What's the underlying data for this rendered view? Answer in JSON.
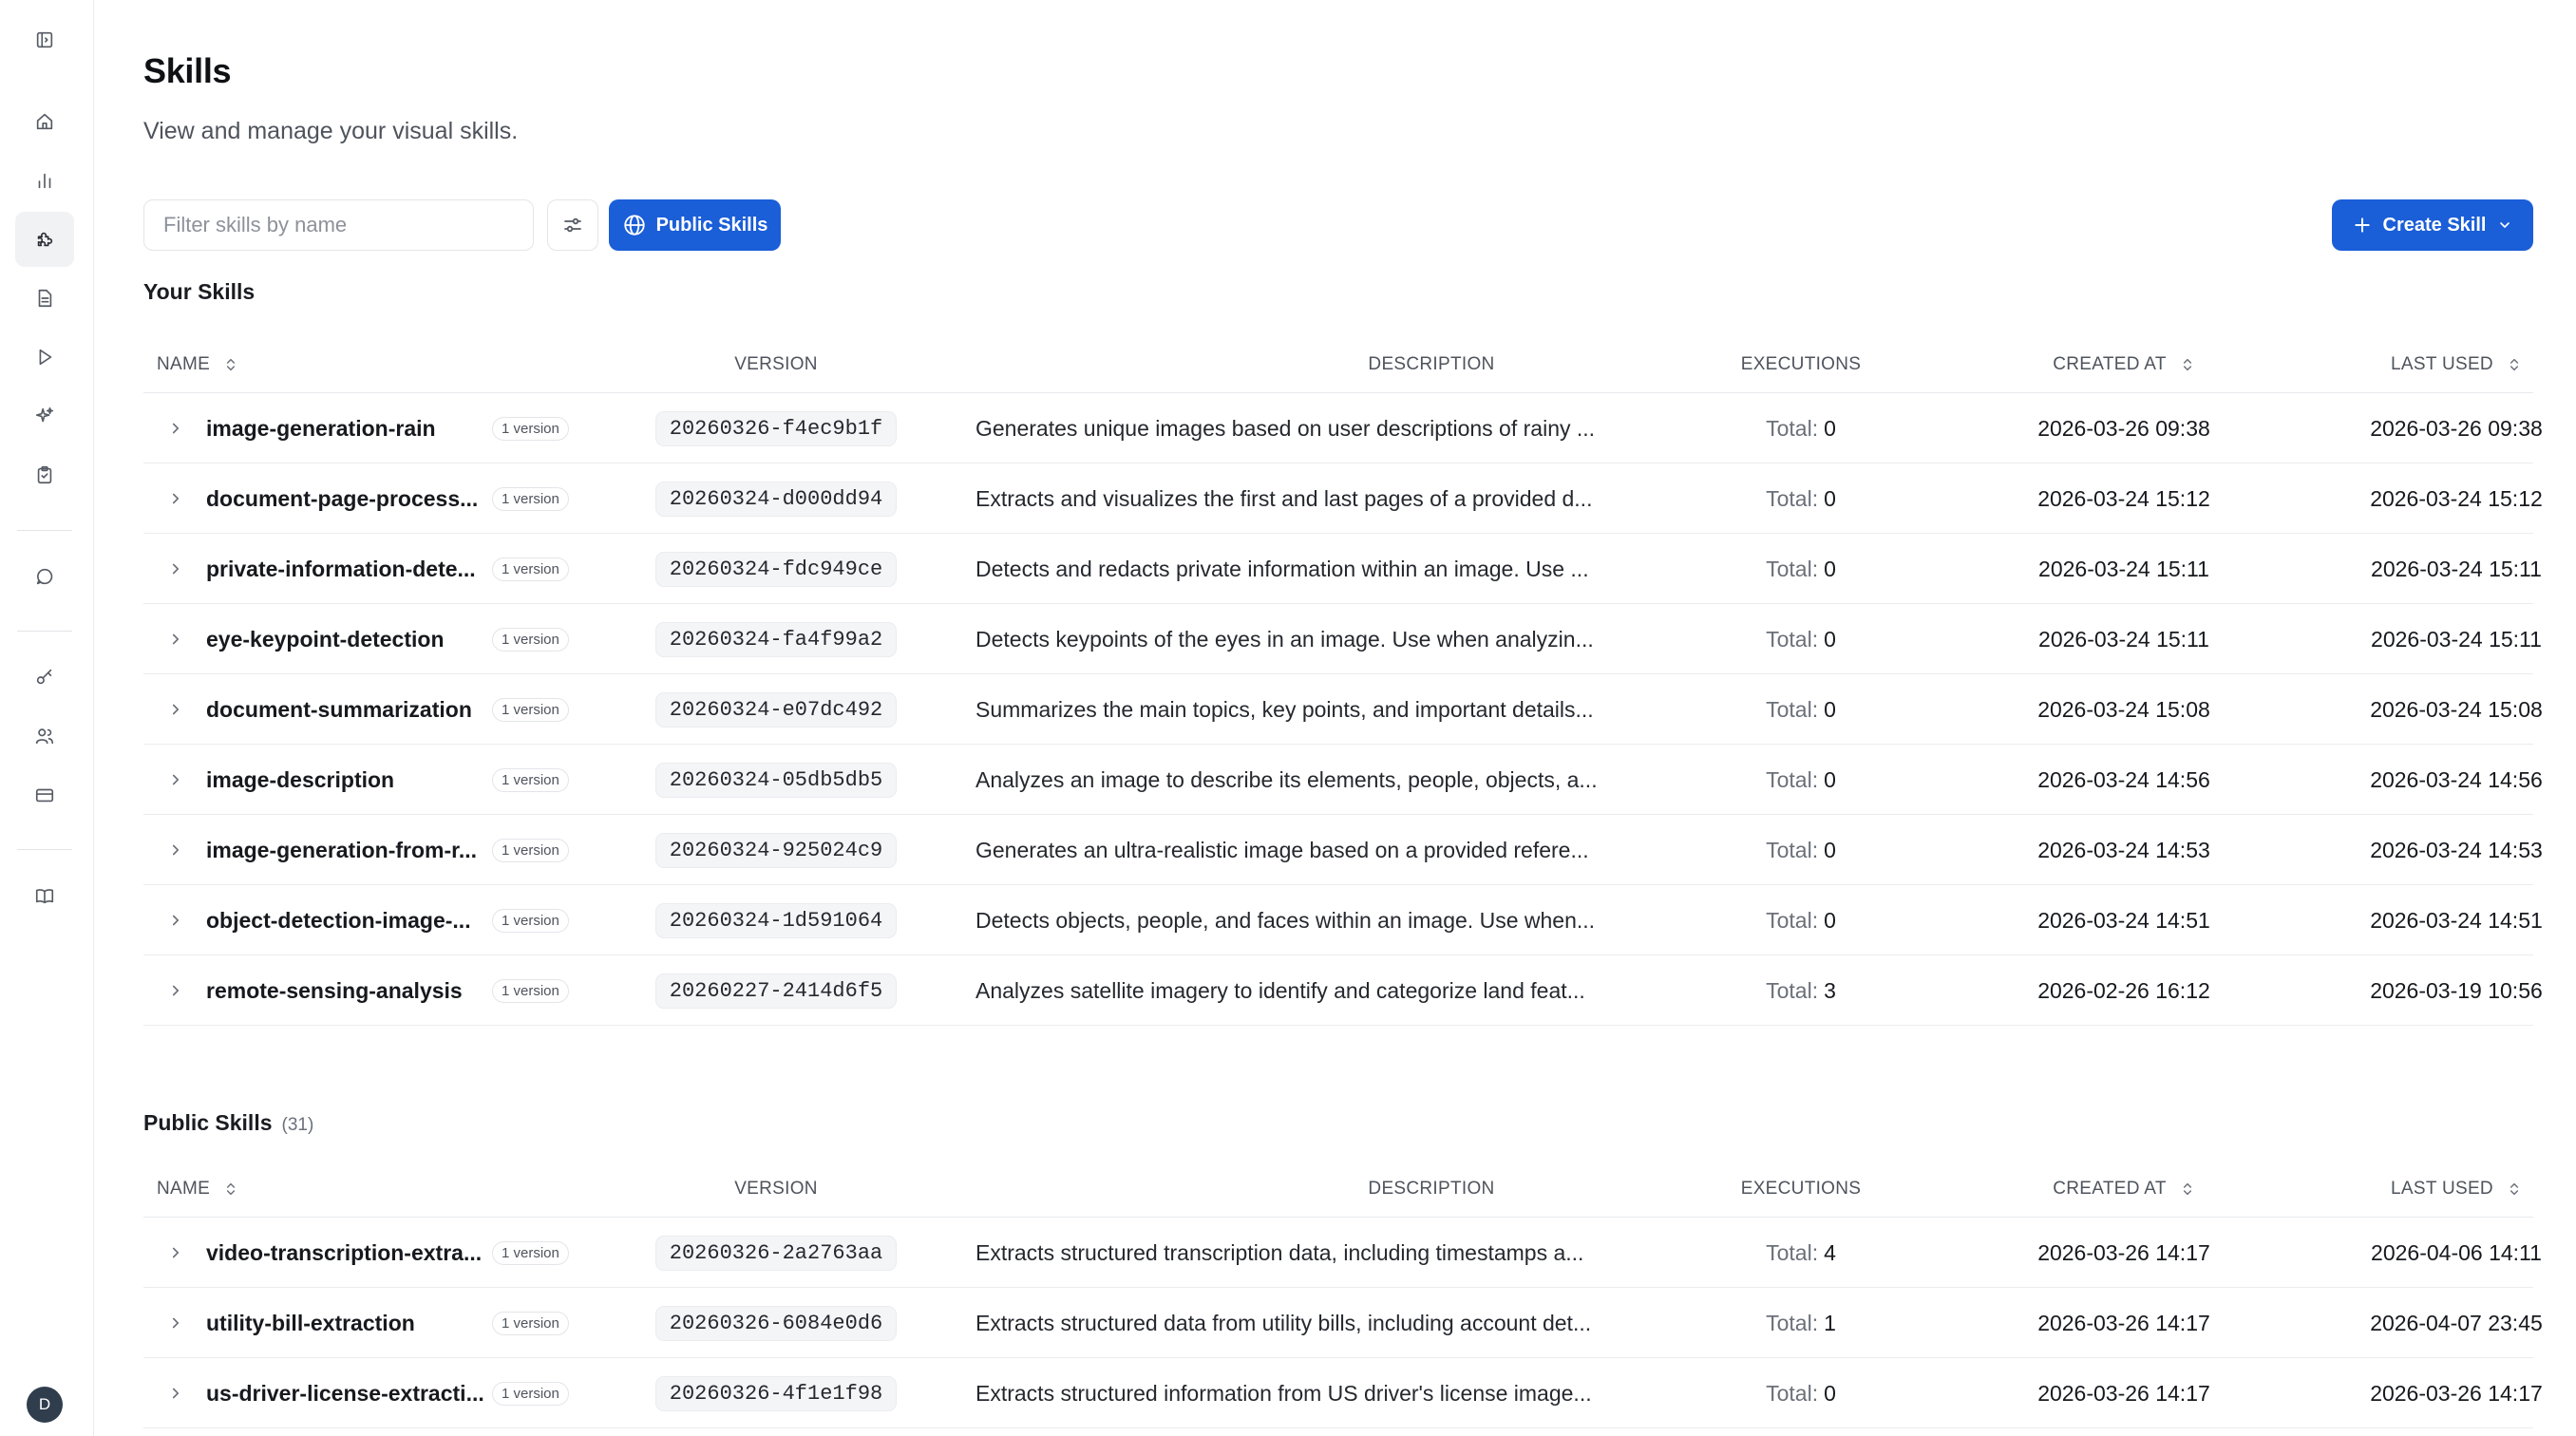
{
  "page": {
    "title": "Skills",
    "subtitle": "View and manage your visual skills."
  },
  "toolbar": {
    "search_placeholder": "Filter skills by name",
    "public_skills_label": "Public Skills",
    "create_skill_label": "Create Skill"
  },
  "sidebar": {
    "items": [
      {
        "icon": "panel-toggle-icon"
      },
      {
        "icon": "home-icon"
      },
      {
        "icon": "bar-chart-icon"
      },
      {
        "icon": "puzzle-icon",
        "active": true
      },
      {
        "icon": "document-icon"
      },
      {
        "icon": "play-icon"
      },
      {
        "icon": "sparkles-icon"
      },
      {
        "icon": "clipboard-check-icon"
      },
      {
        "icon": "chat-icon"
      },
      {
        "icon": "key-icon"
      },
      {
        "icon": "users-icon"
      },
      {
        "icon": "credit-card-icon"
      },
      {
        "icon": "book-icon"
      }
    ],
    "avatar_initial": "D"
  },
  "columns": {
    "name": "NAME",
    "version": "VERSION",
    "description": "DESCRIPTION",
    "executions": "EXECUTIONS",
    "created_at": "CREATED AT",
    "last_used": "LAST USED"
  },
  "your_skills": {
    "title": "Your Skills",
    "rows": [
      {
        "name": "image-generation-rain",
        "badge": "1 version",
        "version": "20260326-f4ec9b1f",
        "description": "Generates unique images based on user descriptions of rainy ...",
        "exec_label": "Total:",
        "exec_value": "0",
        "created": "2026-03-26 09:38",
        "last_used": "2026-03-26 09:38"
      },
      {
        "name": "document-page-process...",
        "badge": "1 version",
        "version": "20260324-d000dd94",
        "description": "Extracts and visualizes the first and last pages of a provided d...",
        "exec_label": "Total:",
        "exec_value": "0",
        "created": "2026-03-24 15:12",
        "last_used": "2026-03-24 15:12"
      },
      {
        "name": "private-information-dete...",
        "badge": "1 version",
        "version": "20260324-fdc949ce",
        "description": "Detects and redacts private information within an image. Use ...",
        "exec_label": "Total:",
        "exec_value": "0",
        "created": "2026-03-24 15:11",
        "last_used": "2026-03-24 15:11"
      },
      {
        "name": "eye-keypoint-detection",
        "badge": "1 version",
        "version": "20260324-fa4f99a2",
        "description": "Detects keypoints of the eyes in an image. Use when analyzin...",
        "exec_label": "Total:",
        "exec_value": "0",
        "created": "2026-03-24 15:11",
        "last_used": "2026-03-24 15:11"
      },
      {
        "name": "document-summarization",
        "badge": "1 version",
        "version": "20260324-e07dc492",
        "description": "Summarizes the main topics, key points, and important details...",
        "exec_label": "Total:",
        "exec_value": "0",
        "created": "2026-03-24 15:08",
        "last_used": "2026-03-24 15:08"
      },
      {
        "name": "image-description",
        "badge": "1 version",
        "version": "20260324-05db5db5",
        "description": "Analyzes an image to describe its elements, people, objects, a...",
        "exec_label": "Total:",
        "exec_value": "0",
        "created": "2026-03-24 14:56",
        "last_used": "2026-03-24 14:56"
      },
      {
        "name": "image-generation-from-r...",
        "badge": "1 version",
        "version": "20260324-925024c9",
        "description": "Generates an ultra-realistic image based on a provided refere...",
        "exec_label": "Total:",
        "exec_value": "0",
        "created": "2026-03-24 14:53",
        "last_used": "2026-03-24 14:53"
      },
      {
        "name": "object-detection-image-...",
        "badge": "1 version",
        "version": "20260324-1d591064",
        "description": "Detects objects, people, and faces within an image. Use when...",
        "exec_label": "Total:",
        "exec_value": "0",
        "created": "2026-03-24 14:51",
        "last_used": "2026-03-24 14:51"
      },
      {
        "name": "remote-sensing-analysis",
        "badge": "1 version",
        "version": "20260227-2414d6f5",
        "description": "Analyzes satellite imagery to identify and categorize land feat...",
        "exec_label": "Total:",
        "exec_value": "3",
        "created": "2026-02-26 16:12",
        "last_used": "2026-03-19 10:56"
      }
    ]
  },
  "public_skills": {
    "title": "Public Skills",
    "count": "(31)",
    "rows": [
      {
        "name": "video-transcription-extra...",
        "badge": "1 version",
        "version": "20260326-2a2763aa",
        "description": "Extracts structured transcription data, including timestamps a...",
        "exec_label": "Total:",
        "exec_value": "4",
        "created": "2026-03-26 14:17",
        "last_used": "2026-04-06 14:11"
      },
      {
        "name": "utility-bill-extraction",
        "badge": "1 version",
        "version": "20260326-6084e0d6",
        "description": "Extracts structured data from utility bills, including account det...",
        "exec_label": "Total:",
        "exec_value": "1",
        "created": "2026-03-26 14:17",
        "last_used": "2026-04-07 23:45"
      },
      {
        "name": "us-driver-license-extracti...",
        "badge": "1 version",
        "version": "20260326-4f1e1f98",
        "description": "Extracts structured information from US driver's license image...",
        "exec_label": "Total:",
        "exec_value": "0",
        "created": "2026-03-26 14:17",
        "last_used": "2026-03-26 14:17"
      }
    ]
  },
  "colors": {
    "accent": "#1a5ed8",
    "sidebar_active_bg": "#f1f2f4",
    "avatar_bg": "#2f3d4d"
  }
}
